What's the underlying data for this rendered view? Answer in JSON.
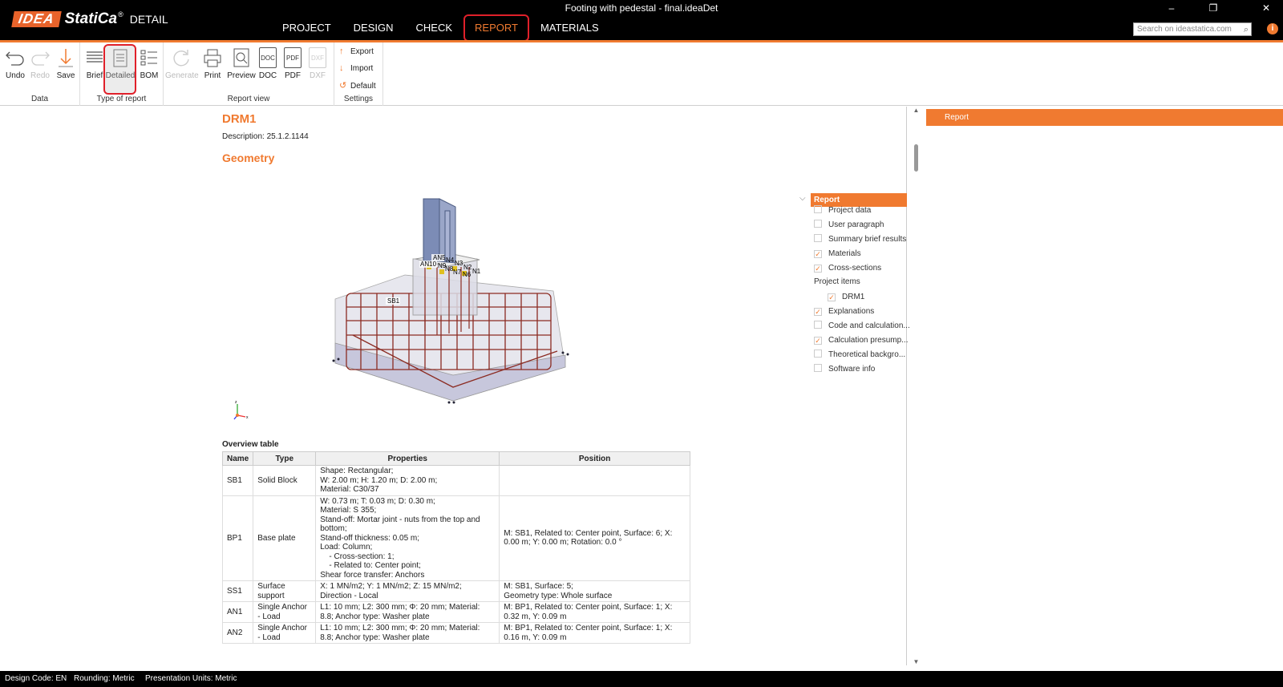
{
  "app": {
    "brand": "IDEA",
    "product": "StatiCa",
    "module": "DETAIL",
    "window_title": "Footing with pedestal - final.ideaDet"
  },
  "tabs": [
    {
      "label": "PROJECT"
    },
    {
      "label": "DESIGN"
    },
    {
      "label": "CHECK"
    },
    {
      "label": "REPORT"
    },
    {
      "label": "MATERIALS"
    }
  ],
  "search": {
    "placeholder": "Search on ideastatica.com"
  },
  "window_controls": {
    "minimize": "–",
    "restore": "❐",
    "close": "✕"
  },
  "info_icon": "i",
  "ribbon": {
    "data_group": "Data",
    "undo": "Undo",
    "redo": "Redo",
    "save": "Save",
    "type_group": "Type of report",
    "brief": "Brief",
    "detailed": "Detailed",
    "bom": "BOM",
    "view_group": "Report view",
    "generate": "Generate",
    "print": "Print",
    "preview": "Preview",
    "doc": "DOC",
    "pdf": "PDF",
    "dxf": "DXF",
    "settings_group": "Settings",
    "export": "Export",
    "import": "Import",
    "default": "Default"
  },
  "report": {
    "title": "DRM1",
    "description": "Description: 25.1.2.1144",
    "geometry_heading": "Geometry",
    "model_labels": [
      "AN10",
      "AN5",
      "N4",
      "N3",
      "N2",
      "N9",
      "N8",
      "N7",
      "N6",
      "N1",
      "SB1"
    ],
    "overview_title": "Overview table",
    "columns": [
      "Name",
      "Type",
      "Properties",
      "Position"
    ],
    "rows": [
      {
        "name": "SB1",
        "type": "Solid Block",
        "props": [
          "Shape: Rectangular;",
          "W: 2.00 m; H: 1.20 m; D: 2.00 m;",
          "Material: C30/37"
        ],
        "pos": []
      },
      {
        "name": "BP1",
        "type": "Base plate",
        "props": [
          "W: 0.73 m; T: 0.03 m; D: 0.30 m;",
          "Material: S 355;",
          "Stand-off: Mortar joint - nuts from the top and",
          "bottom;",
          "Stand-off thickness: 0.05 m;",
          "Load: Column;",
          "    - Cross-section: 1;",
          "    - Related to: Center point;",
          "Shear force transfer: Anchors"
        ],
        "pos": [
          "M: SB1, Related to: Center point, Surface: 6; X:",
          "0.00 m; Y: 0.00 m; Rotation: 0.0 °"
        ]
      },
      {
        "name": "SS1",
        "type": "Surface support",
        "props": [
          "X: 1 MN/m2; Y: 1 MN/m2; Z: 15 MN/m2;",
          "Direction - Local"
        ],
        "pos": [
          "M: SB1, Surface: 5;",
          "Geometry type: Whole surface"
        ]
      },
      {
        "name": "AN1",
        "type": "Single Anchor - Load",
        "props": [
          "L1: 10 mm; L2: 300 mm; Φ: 20 mm; Material:",
          "8.8; Anchor type: Washer plate"
        ],
        "pos": [
          "M: BP1, Related to: Center point, Surface: 1; X:",
          "0.32 m, Y: 0.09 m"
        ]
      },
      {
        "name": "AN2",
        "type": "Single Anchor - Load",
        "props": [
          "L1: 10 mm; L2: 300 mm; Φ: 20 mm; Material:",
          "8.8; Anchor type: Washer plate"
        ],
        "pos": [
          "M: BP1, Related to: Center point, Surface: 1; X:",
          "0.16 m, Y: 0.09 m"
        ]
      }
    ]
  },
  "toc": {
    "header": "Report",
    "items": [
      {
        "label": "Project data",
        "checked": false
      },
      {
        "label": "User paragraph",
        "checked": false
      },
      {
        "label": "Summary brief results",
        "checked": false
      },
      {
        "label": "Materials",
        "checked": true
      },
      {
        "label": "Cross-sections",
        "checked": true
      }
    ],
    "project_items_label": "Project items",
    "sub_item": {
      "label": "DRM1",
      "checked": true
    },
    "items2": [
      {
        "label": "Explanations",
        "checked": true
      },
      {
        "label": "Code and calculation...",
        "checked": false
      },
      {
        "label": "Calculation presump...",
        "checked": true
      },
      {
        "label": "Theoretical backgro...",
        "checked": false
      },
      {
        "label": "Software info",
        "checked": false
      }
    ]
  },
  "right_panel": {
    "title": "Report"
  },
  "status": {
    "design_code": "Design Code: EN",
    "rounding": "Rounding: Metric",
    "units": "Presentation Units: Metric"
  },
  "colors": {
    "accent": "#f07a30",
    "highlight": "#e0202a",
    "titlebar": "#000000"
  }
}
